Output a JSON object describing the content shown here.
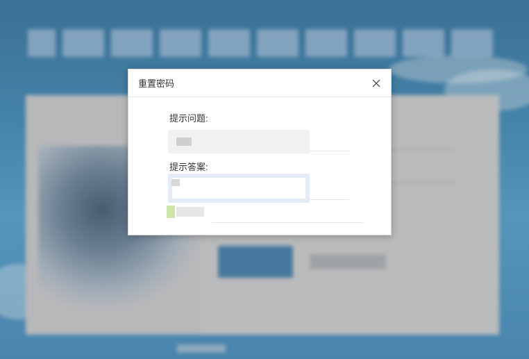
{
  "dialog": {
    "title": "重置密码",
    "close_icon": "close-icon",
    "question_label": "提示问题:",
    "question_value": "",
    "answer_label": "提示答案:",
    "answer_value": ""
  },
  "colors": {
    "background_blue": "#3b86b4",
    "login_button": "#3d78a6",
    "dialog_border": "#d6d6d6",
    "input_focus_ring": "#e3ecf7"
  }
}
